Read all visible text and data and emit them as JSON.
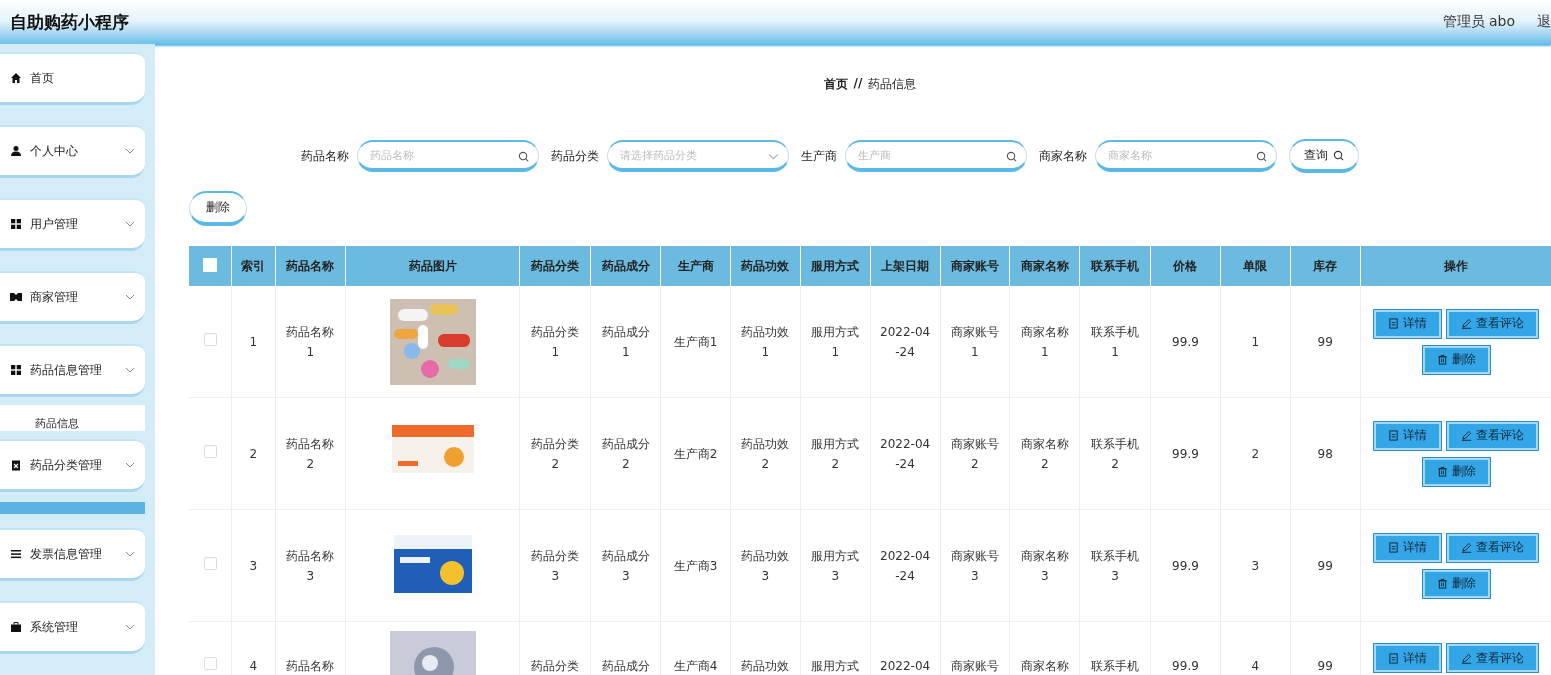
{
  "header": {
    "title": "自助购药小程序",
    "user": "管理员 abo",
    "logout": "退"
  },
  "sidebar": {
    "items": [
      {
        "label": "首页",
        "expandable": false
      },
      {
        "label": "个人中心",
        "expandable": true
      },
      {
        "label": "用户管理",
        "expandable": true
      },
      {
        "label": "商家管理",
        "expandable": true
      },
      {
        "label": "药品信息管理",
        "expandable": true,
        "children": [
          {
            "label": "药品信息"
          }
        ]
      },
      {
        "label": "药品分类管理",
        "expandable": true
      },
      {
        "label": "发票信息管理",
        "expandable": true
      },
      {
        "label": "系统管理",
        "expandable": true
      }
    ]
  },
  "breadcrumb": [
    "首页",
    "//",
    "药品信息"
  ],
  "filters": [
    {
      "label": "药品名称",
      "placeholder": "药品名称",
      "kind": "search"
    },
    {
      "label": "药品分类",
      "placeholder": "请选择药品分类",
      "kind": "select"
    },
    {
      "label": "生产商",
      "placeholder": "生产商",
      "kind": "search"
    },
    {
      "label": "商家名称",
      "placeholder": "商家名称",
      "kind": "search"
    }
  ],
  "query_button": "查询",
  "delete_button": "删除",
  "table": {
    "select_all": false,
    "columns": [
      "索引",
      "药品名称",
      "药品图片",
      "药品分类",
      "药品成分",
      "生产商",
      "药品功效",
      "服用方式",
      "上架日期",
      "商家账号",
      "商家名称",
      "联系手机",
      "价格",
      "单限",
      "库存",
      "操作"
    ],
    "rows": [
      {
        "checked": false,
        "cells": [
          "1",
          "药品名称\n1",
          {
            "kind": "picture"
          },
          "药品分类\n1",
          "药品成分\n1",
          "生产商1",
          "药品功效\n1",
          "服用方式\n1",
          "2022-04\n-24",
          "商家账号\n1",
          "商家名称\n1",
          "联系手机\n1",
          "99.9",
          "1",
          "99"
        ],
        "actions": [
          "详情",
          "查看评论",
          "删除"
        ]
      },
      {
        "checked": false,
        "cells": [
          "2",
          "药品名称\n2",
          {
            "kind": "picture"
          },
          "药品分类\n2",
          "药品成分\n2",
          "生产商2",
          "药品功效\n2",
          "服用方式\n2",
          "2022-04\n-24",
          "商家账号\n2",
          "商家名称\n2",
          "联系手机\n2",
          "99.9",
          "2",
          "98"
        ],
        "actions": [
          "详情",
          "查看评论",
          "删除"
        ]
      },
      {
        "checked": false,
        "cells": [
          "3",
          "药品名称\n3",
          {
            "kind": "picture"
          },
          "药品分类\n3",
          "药品成分\n3",
          "生产商3",
          "药品功效\n3",
          "服用方式\n3",
          "2022-04\n-24",
          "商家账号\n3",
          "商家名称\n3",
          "联系手机\n3",
          "99.9",
          "3",
          "99"
        ],
        "actions": [
          "详情",
          "查看评论",
          "删除"
        ]
      },
      {
        "checked": false,
        "cells": [
          "4",
          "药品名称",
          {
            "kind": "picture"
          },
          "药品分类",
          "药品成分",
          "生产商4",
          "药品功效",
          "服用方式",
          "2022-04",
          "商家账号",
          "商家名称",
          "联系手机",
          "99.9",
          "4",
          "99"
        ],
        "actions": [
          "详情",
          "查看评论"
        ]
      }
    ]
  }
}
